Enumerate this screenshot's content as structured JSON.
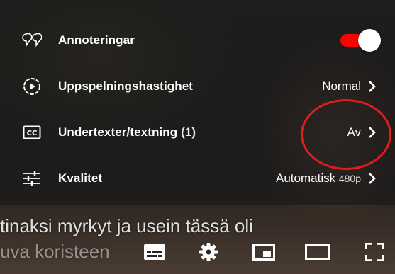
{
  "settings_menu": {
    "items": [
      {
        "label": "Annoteringar",
        "icon": "annotations-icon",
        "toggle_on": true
      },
      {
        "label": "Uppspelningshastighet",
        "icon": "playback-speed-icon",
        "value": "Normal"
      },
      {
        "label": "Undertexter/textning",
        "label_extra": "(1)",
        "icon": "closed-captions-icon",
        "value": "Av"
      },
      {
        "label": "Kvalitet",
        "icon": "quality-sliders-icon",
        "value": "Automatisk",
        "value_sub": "480p"
      }
    ]
  },
  "subtitles": {
    "line1": "tinaksi myrkyt ja usein tässä oli",
    "line2": "uva koristeen"
  },
  "controls": [
    "subtitles-icon",
    "settings-gear-icon",
    "miniplayer-icon",
    "theater-mode-icon",
    "fullscreen-icon"
  ],
  "colors": {
    "toggle_on": "#ff0000",
    "annotation_circle": "#e21b1b",
    "menu_bg": "#1c1c1c"
  }
}
